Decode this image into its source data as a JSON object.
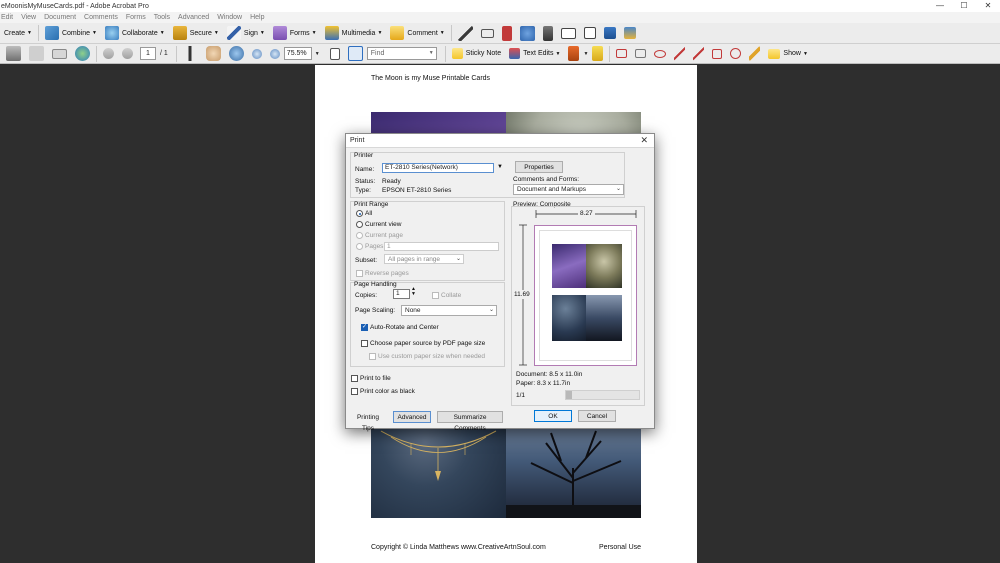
{
  "window": {
    "title": "eMoonisMyMuseCards.pdf - Adobe Acrobat Pro",
    "controls": [
      "—",
      "☐",
      "✕"
    ]
  },
  "menu": [
    "Edit",
    "View",
    "Document",
    "Comments",
    "Forms",
    "Tools",
    "Advanced",
    "Window",
    "Help"
  ],
  "toolbar": {
    "create": "Create",
    "combine": "Combine",
    "collaborate": "Collaborate",
    "secure": "Secure",
    "sign": "Sign",
    "forms": "Forms",
    "multimedia": "Multimedia",
    "comment": "Comment"
  },
  "toolbar2": {
    "page_current": "1",
    "page_total": "/ 1",
    "zoom": "75.5%",
    "find_placeholder": "Find",
    "sticky_note": "Sticky Note",
    "text_edits": "Text Edits",
    "show": "Show"
  },
  "document": {
    "title": "The Moon is my Muse Printable Cards",
    "footer_left": "Copyright © Linda Matthews www.CreativeArtnSoul.com",
    "footer_right": "Personal Use"
  },
  "dialog": {
    "title": "Print",
    "printer_group": "Printer",
    "name_label": "Name:",
    "name_value": "ET-2810 Series(Network)",
    "status_label": "Status:",
    "status_value": "Ready",
    "type_label": "Type:",
    "type_value": "EPSON ET-2810 Series",
    "properties": "Properties",
    "comments_forms_label": "Comments and Forms:",
    "comments_forms_value": "Document and Markups",
    "print_range_group": "Print Range",
    "range_all": "All",
    "range_current_view": "Current view",
    "range_current_page": "Current page",
    "range_pages": "Pages",
    "range_pages_value": "1",
    "subset_label": "Subset:",
    "subset_value": "All pages in range",
    "reverse_pages": "Reverse pages",
    "page_handling_group": "Page Handling",
    "copies_label": "Copies:",
    "copies_value": "1",
    "collate": "Collate",
    "page_scaling_label": "Page Scaling:",
    "page_scaling_value": "None",
    "auto_rotate": "Auto-Rotate and Center",
    "choose_paper_source": "Choose paper source by PDF page size",
    "use_custom_paper": "Use custom paper size when needed",
    "print_to_file": "Print to file",
    "print_color_black": "Print color as black",
    "preview_label": "Preview: Composite",
    "preview_width": "8.27",
    "preview_height": "11.69",
    "document_size": "Document: 8.5 x 11.0in",
    "paper_size": "Paper: 8.3 x 11.7in",
    "page_indicator": "1/1",
    "printing_tips": "Printing Tips",
    "advanced": "Advanced",
    "summarize_comments": "Summarize Comments",
    "ok": "OK",
    "cancel": "Cancel"
  },
  "colors": {
    "accent": "#0078d7",
    "doc_background": "#2e2e2e",
    "dialog_background": "#f0f0f0"
  }
}
